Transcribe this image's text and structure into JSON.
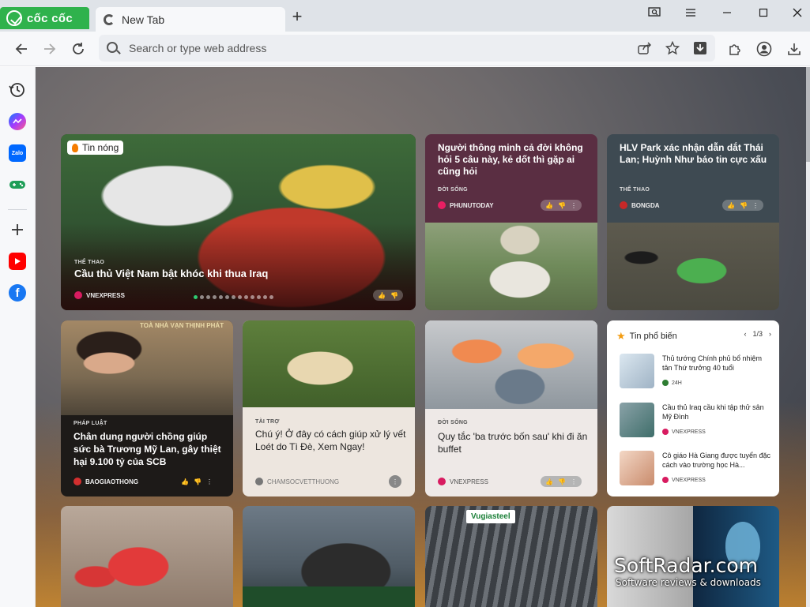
{
  "browser": {
    "brand": "cốc cốc",
    "tab_title": "New Tab",
    "new_tab": "+",
    "search_placeholder": "Search or type web address"
  },
  "hero": {
    "badge": "Tin nóng",
    "category": "THỂ THAO",
    "title": "Cầu thủ Việt Nam bật khóc khi thua Iraq",
    "source": "VNEXPRESS"
  },
  "cards": {
    "c1": {
      "title": "Người thông minh cả đời không hỏi 5 câu này, kẻ dốt thì gặp ai cũng hỏi",
      "category": "ĐỜI SỐNG",
      "source": "PHUNUTODAY"
    },
    "c2": {
      "title": "HLV Park xác nhận dẫn dắt Thái Lan; Huỳnh Như báo tin cực xấu",
      "category": "THỂ THAO",
      "source": "BONGDA"
    },
    "c3": {
      "title": "Chân dung người chồng giúp sức bà Trương Mỹ Lan, gây thiệt hại 9.100 tỷ của SCB",
      "category": "PHÁP LUẬT",
      "source": "BAOGIAOTHONG",
      "sign": "TOÀ NHÀ VẠN THỊNH PHÁT"
    },
    "c4": {
      "title": "Chú ý! Ở đây có cách giúp xử lý vết Loét do Tì Đè, Xem Ngay!",
      "category": "TÀI TRỢ",
      "source": "CHAMSOCVETTHUONG"
    },
    "c5": {
      "title": "Quy tắc 'ba trước bốn sau' khi đi ăn buffet",
      "category": "ĐỜI SỐNG",
      "source": "VNEXPRESS"
    }
  },
  "popular": {
    "heading": "Tin phổ biến",
    "pager": "1/3",
    "items": [
      {
        "title": "Thủ tướng Chính phủ bổ nhiệm tân Thứ trưởng 40 tuổi",
        "source": "24H"
      },
      {
        "title": "Cầu thủ Iraq cầu khi tập thử sân Mỹ Đình",
        "source": "VNEXPRESS"
      },
      {
        "title": "Cô giáo Hà Giang được tuyển đặc cách vào trường học Hà...",
        "source": "VNEXPRESS"
      }
    ]
  },
  "row3": {
    "steel_sign": "Vugiasteel"
  },
  "watermark": {
    "title": "SoftRadar.com",
    "subtitle": "Software reviews & downloads"
  },
  "colors": {
    "brand_green": "#2fb24c",
    "hot_badge": "#f57c00",
    "source_pink": "#d81b60"
  }
}
